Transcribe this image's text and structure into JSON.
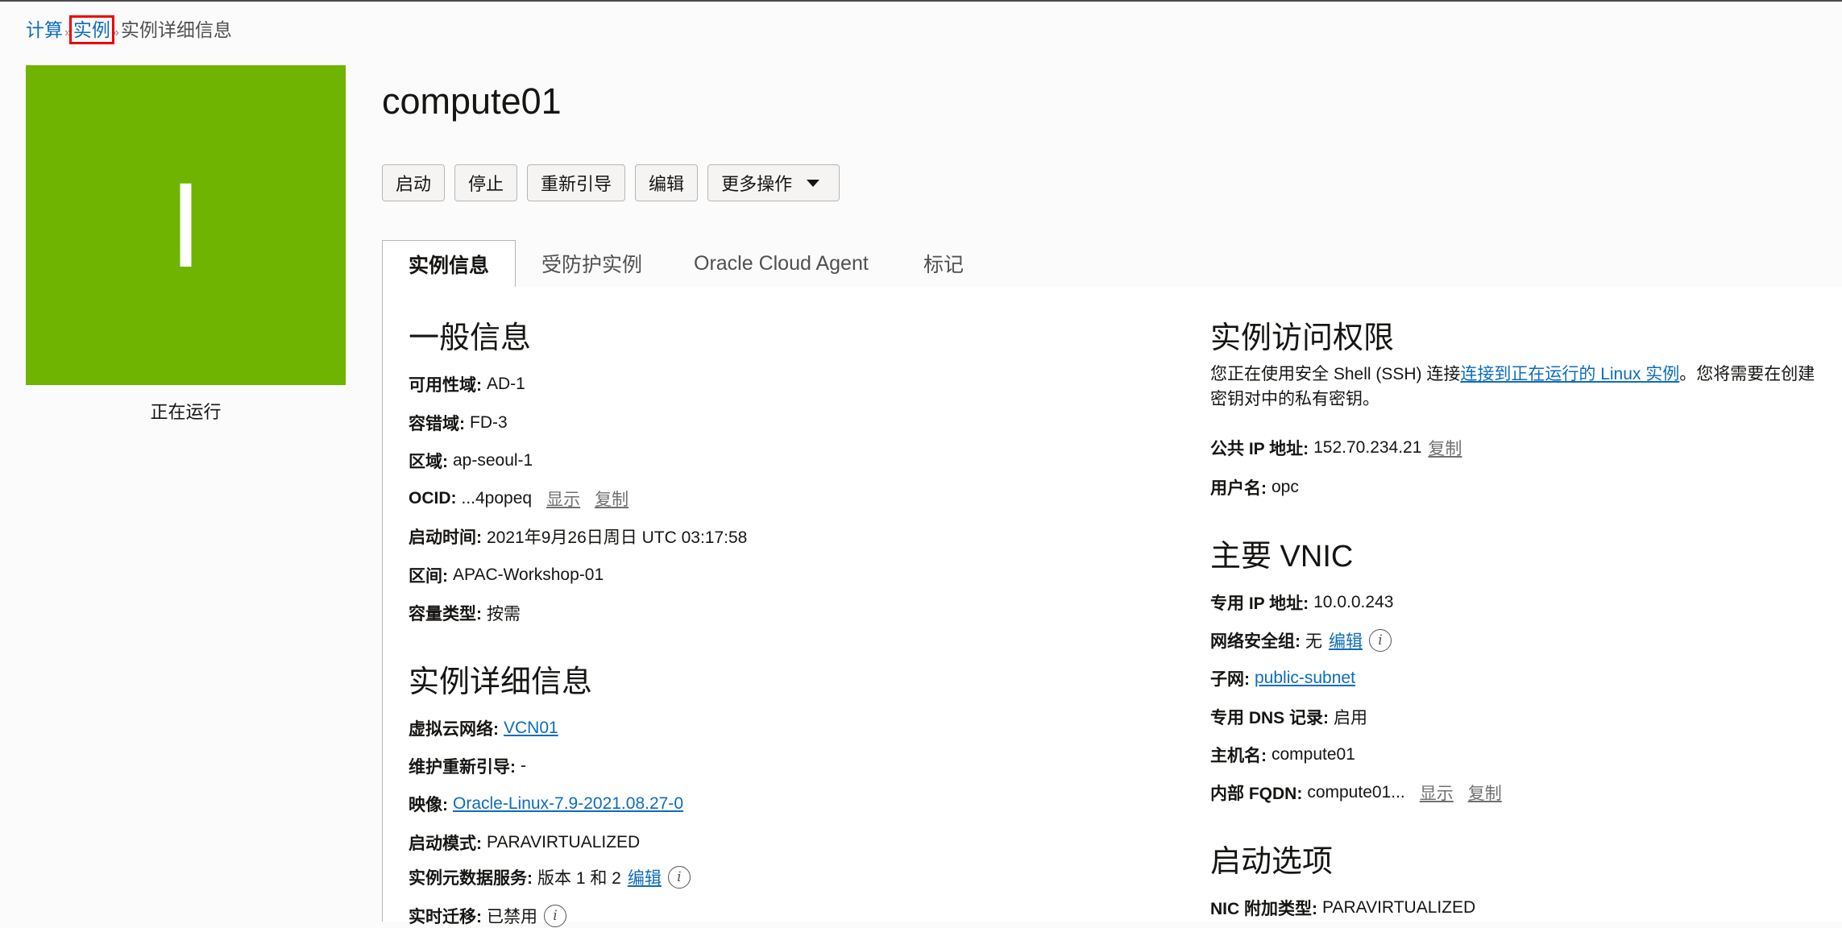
{
  "breadcrumb": {
    "compute": "计算",
    "sep": "»",
    "instances": "实例",
    "current": "实例详细信息"
  },
  "instance": {
    "tile_letter": "I",
    "tile_color": "#6fb400",
    "status": "正在运行",
    "name": "compute01"
  },
  "actions": {
    "start": "启动",
    "stop": "停止",
    "reboot": "重新引导",
    "edit": "编辑",
    "more": "更多操作",
    "more_icon": "chevron-down-icon"
  },
  "tabs": [
    {
      "label": "实例信息",
      "active": true
    },
    {
      "label": "受防护实例",
      "active": false
    },
    {
      "label": "Oracle Cloud Agent",
      "active": false
    },
    {
      "label": "标记",
      "active": false
    }
  ],
  "general": {
    "heading": "一般信息",
    "ad": {
      "label": "可用性域:",
      "value": "AD-1"
    },
    "fd": {
      "label": "容错域:",
      "value": "FD-3"
    },
    "region": {
      "label": "区域:",
      "value": "ap-seoul-1"
    },
    "ocid": {
      "label": "OCID:",
      "value": "...4popeq",
      "show": "显示",
      "copy": "复制"
    },
    "launched": {
      "label": "启动时间:",
      "value": "2021年9月26日周日 UTC 03:17:58"
    },
    "compartment": {
      "label": "区间:",
      "value": "APAC-Workshop-01"
    },
    "capacity": {
      "label": "容量类型:",
      "value": "按需"
    }
  },
  "details": {
    "heading": "实例详细信息",
    "vcn": {
      "label": "虚拟云网络:",
      "value": "VCN01"
    },
    "maint": {
      "label": "维护重新引导:",
      "value": "-"
    },
    "image": {
      "label": "映像:",
      "value": "Oracle-Linux-7.9-2021.08.27-0"
    },
    "launch_mode": {
      "label": "启动模式:",
      "value": "PARAVIRTUALIZED"
    },
    "imds": {
      "label": "实例元数据服务:",
      "value": "版本 1 和 2",
      "edit": "编辑"
    },
    "live_migration": {
      "label": "实时迁移:",
      "value": "已禁用"
    }
  },
  "access": {
    "heading": "实例访问权限",
    "text_before": "您正在使用安全 Shell (SSH) 连接",
    "link": "连接到正在运行的 Linux 实例",
    "text_after": "。您将需要在创建",
    "text_line2": "密钥对中的私有密钥。",
    "public_ip": {
      "label": "公共 IP 地址:",
      "value": "152.70.234.21",
      "copy": "复制"
    },
    "username": {
      "label": "用户名:",
      "value": "opc"
    }
  },
  "vnic": {
    "heading": "主要 VNIC",
    "private_ip": {
      "label": "专用 IP 地址:",
      "value": "10.0.0.243"
    },
    "nsg": {
      "label": "网络安全组:",
      "value": "无",
      "edit": "编辑"
    },
    "subnet": {
      "label": "子网:",
      "value": "public-subnet"
    },
    "dns": {
      "label": "专用 DNS 记录:",
      "value": "启用"
    },
    "hostname": {
      "label": "主机名:",
      "value": "compute01"
    },
    "fqdn": {
      "label": "内部 FQDN:",
      "value": "compute01...",
      "show": "显示",
      "copy": "复制"
    }
  },
  "launch_options": {
    "heading": "启动选项",
    "nic": {
      "label": "NIC 附加类型:",
      "value": "PARAVIRTUALIZED"
    }
  }
}
